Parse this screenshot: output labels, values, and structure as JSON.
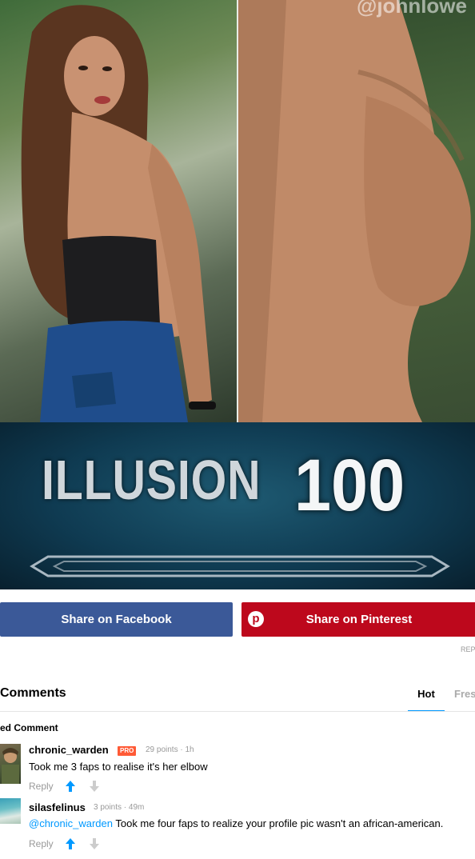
{
  "meme": {
    "watermark": "@johnlowe",
    "caption_word": "ILLUSION",
    "caption_number": "100"
  },
  "share": {
    "facebook_label": "Share on Facebook",
    "pinterest_label": "Share on Pinterest",
    "pinterest_icon": "p",
    "report_label": "REP"
  },
  "comments": {
    "title": "Comments",
    "tabs": [
      {
        "label": "Hot",
        "active": true
      },
      {
        "label": "Fres",
        "active": false
      }
    ],
    "featured_label": "ed Comment",
    "items": [
      {
        "user": "chronic_warden",
        "badge": "PRO",
        "meta": "29 points · 1h",
        "mention": "",
        "text": "Took me 3 faps to realise it's her elbow",
        "reply_label": "Reply"
      },
      {
        "user": "silasfelinus",
        "badge": "",
        "meta": "3 points · 49m",
        "mention": "@chronic_warden",
        "text": " Took me four faps to realize your profile pic wasn't an african-american.",
        "reply_label": "Reply"
      }
    ]
  },
  "colors": {
    "facebook": "#3b5998",
    "pinterest": "#bd081c",
    "accent": "#0099ff",
    "pro_badge": "#ff5a36"
  }
}
